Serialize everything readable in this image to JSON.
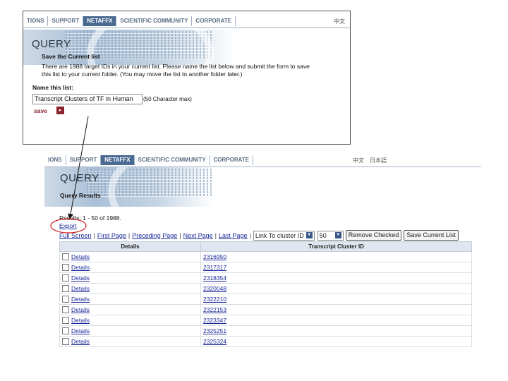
{
  "panel1": {
    "nav": [
      "TIONS",
      "SUPPORT",
      "NETAFFX",
      "SCIENTIFIC COMMUNITY",
      "CORPORATE"
    ],
    "lang": "中文",
    "query_title": "QUERY",
    "heading": "Save the Current list",
    "description_line1": "There are 1988 target IDs in your current list. Please name the list below and submit the form to save",
    "description_line2": "this list to your current folder. (You may move the list to another folder later.)",
    "name_label": "Name this list:",
    "name_value": "Transcript Clusters of TF in Human",
    "name_hint": "(50 Character max)",
    "save_label": "save"
  },
  "panel2": {
    "nav": [
      "IONS",
      "SUPPORT",
      "NETAFFX",
      "SCIENTIFIC COMMUNITY",
      "CORPORATE"
    ],
    "lang1": "中文",
    "lang2": "日本語",
    "query_title": "QUERY",
    "subtitle": "Query Results",
    "results_text": "Results: 1 - 50 of 1988.",
    "export_label": "Export",
    "toolbar": {
      "full_screen": "Full Screen",
      "first_page": "First Page",
      "preceding_page": "Preceding Page",
      "next_page": "Next Page",
      "last_page": "Last Page",
      "select_value": "Link To cluster ID",
      "page_size": "50",
      "remove_checked": "Remove Checked",
      "save_current_list": "Save Current List"
    },
    "table": {
      "headers": [
        "Details",
        "Transcript Cluster ID"
      ],
      "rows": [
        [
          "Details",
          "2316950"
        ],
        [
          "Details",
          "2317317"
        ],
        [
          "Details",
          "2318354"
        ],
        [
          "Details",
          "2320048"
        ],
        [
          "Details",
          "2322210"
        ],
        [
          "Details",
          "2322153"
        ],
        [
          "Details",
          "2323347"
        ],
        [
          "Details",
          "2325251"
        ],
        [
          "Details",
          "2325324"
        ]
      ]
    }
  },
  "colors": {
    "nav_active": "#4a6a92",
    "link": "#1a2a9a",
    "annotation": "#d02020",
    "save_icon": "#8c2430"
  }
}
